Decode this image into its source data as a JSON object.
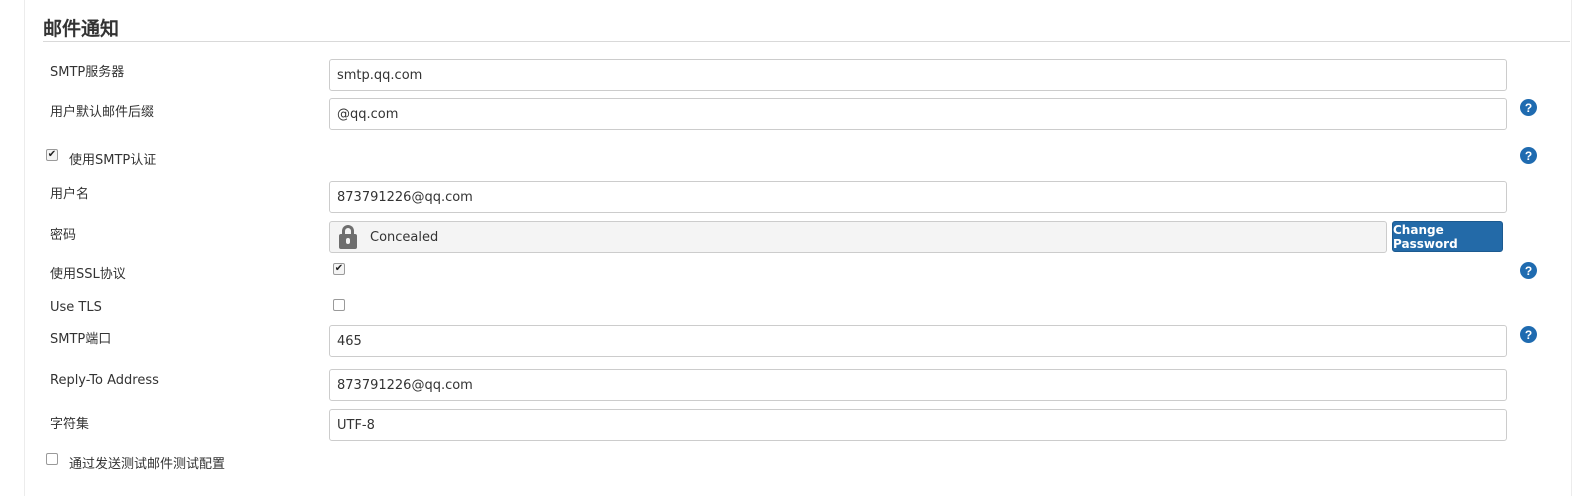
{
  "section": {
    "title": "邮件通知"
  },
  "fields": {
    "smtp_server": {
      "label": "SMTP服务器",
      "value": "smtp.qq.com"
    },
    "default_suffix": {
      "label": "用户默认邮件后缀",
      "value": "@qq.com"
    },
    "use_smtp_auth": {
      "label": "使用SMTP认证",
      "checked": true
    },
    "username": {
      "label": "用户名",
      "value": "873791226@qq.com"
    },
    "password": {
      "label": "密码",
      "concealed_text": "Concealed",
      "button_label": "Change Password"
    },
    "use_ssl": {
      "label": "使用SSL协议",
      "checked": true
    },
    "use_tls": {
      "label": "Use TLS",
      "checked": false
    },
    "smtp_port": {
      "label": "SMTP端口",
      "value": "465"
    },
    "reply_to": {
      "label": "Reply-To Address",
      "value": "873791226@qq.com"
    },
    "charset": {
      "label": "字符集",
      "value": "UTF-8"
    },
    "test_config": {
      "label": "通过发送测试邮件测试配置",
      "checked": false
    }
  },
  "help": {
    "glyph": "?"
  },
  "checkmark": "✔",
  "colors": {
    "primary_button": "#236aa8",
    "help_icon": "#1f6bb0"
  }
}
